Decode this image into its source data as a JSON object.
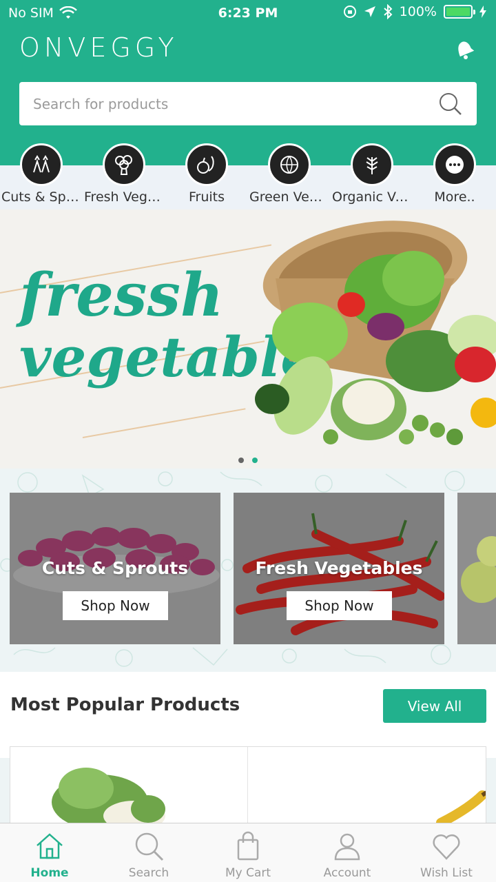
{
  "status_bar": {
    "carrier": "No SIM",
    "time": "6:23 PM",
    "battery": "100%"
  },
  "header": {
    "logo_text": "ONVEGGY",
    "search_placeholder": "Search for products"
  },
  "categories": [
    {
      "label": "Cuts & Sprouts",
      "icon": "sprouts-icon"
    },
    {
      "label": "Fresh Vegetables",
      "icon": "broccoli-icon"
    },
    {
      "label": "Fruits",
      "icon": "fruits-icon"
    },
    {
      "label": "Green Vegetables",
      "icon": "cabbage-icon"
    },
    {
      "label": "Organic Vegetables",
      "icon": "organic-leaf-icon"
    },
    {
      "label": "More..",
      "icon": "more-icon"
    }
  ],
  "banner": {
    "line1": "fressh",
    "line2": "vegetable",
    "slide_count": 2,
    "active_slide": 2
  },
  "category_cards": [
    {
      "title": "Cuts & Sprouts",
      "button": "Shop Now"
    },
    {
      "title": "Fresh Vegetables",
      "button": "Shop Now"
    }
  ],
  "popular": {
    "title": "Most Popular Products",
    "view_all": "View All"
  },
  "tabbar": [
    {
      "label": "Home",
      "icon": "home-icon",
      "active": true
    },
    {
      "label": "Search",
      "icon": "search-icon",
      "active": false
    },
    {
      "label": "My Cart",
      "icon": "cart-bag-icon",
      "active": false
    },
    {
      "label": "Account",
      "icon": "account-icon",
      "active": false
    },
    {
      "label": "Wish List",
      "icon": "heart-icon",
      "active": false
    }
  ],
  "colors": {
    "brand": "#22b18d",
    "battery": "#4cd964"
  }
}
